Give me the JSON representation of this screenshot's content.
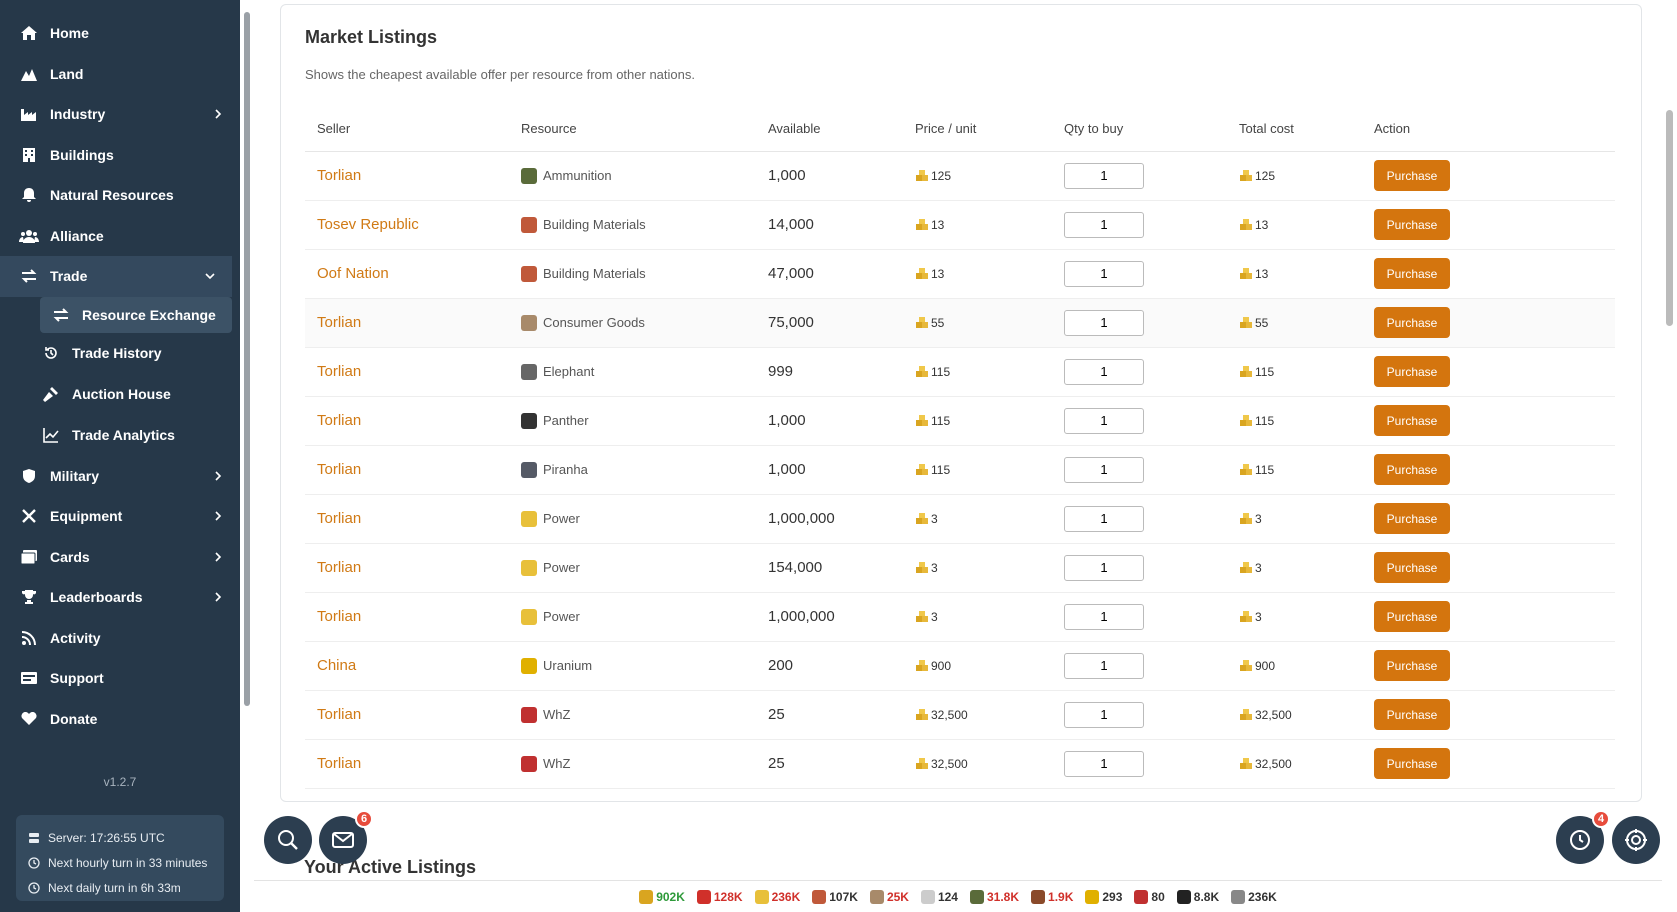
{
  "sidebar": {
    "items": [
      {
        "label": "Home",
        "icon": "home-icon"
      },
      {
        "label": "Land",
        "icon": "mountain-icon"
      },
      {
        "label": "Industry",
        "icon": "factory-icon"
      },
      {
        "label": "Buildings",
        "icon": "building-icon"
      },
      {
        "label": "Natural Resources",
        "icon": "bell-icon"
      },
      {
        "label": "Alliance",
        "icon": "users-icon"
      },
      {
        "label": "Trade",
        "icon": "exchange-icon"
      },
      {
        "label": "Military",
        "icon": "shield-icon"
      },
      {
        "label": "Equipment",
        "icon": "tools-icon"
      },
      {
        "label": "Cards",
        "icon": "images-icon"
      },
      {
        "label": "Leaderboards",
        "icon": "trophy-icon"
      },
      {
        "label": "Activity",
        "icon": "rss-icon"
      },
      {
        "label": "Support",
        "icon": "card-icon"
      },
      {
        "label": "Donate",
        "icon": "heart-icon"
      }
    ],
    "trade_sub": [
      {
        "label": "Resource Exchange"
      },
      {
        "label": "Trade History"
      },
      {
        "label": "Auction House"
      },
      {
        "label": "Trade Analytics"
      }
    ],
    "version": "v1.2.7",
    "server_time": "Server: 17:26:55 UTC",
    "next_hourly": "Next hourly turn in 33 minutes",
    "next_daily": "Next daily turn in 6h 33m"
  },
  "market": {
    "title": "Market Listings",
    "subtitle": "Shows the cheapest available offer per resource from other nations.",
    "headers": {
      "seller": "Seller",
      "resource": "Resource",
      "available": "Available",
      "price": "Price / unit",
      "qty": "Qty to buy",
      "total": "Total cost",
      "action": "Action"
    },
    "purchase_label": "Purchase",
    "rows": [
      {
        "seller": "Torlian",
        "resource": "Ammunition",
        "available": "1,000",
        "price": "125",
        "qty": "1",
        "total": "125",
        "color": "#5a6b3a"
      },
      {
        "seller": "Tosev Republic",
        "resource": "Building Materials",
        "available": "14,000",
        "price": "13",
        "qty": "1",
        "total": "13",
        "color": "#c0593a"
      },
      {
        "seller": "Oof Nation",
        "resource": "Building Materials",
        "available": "47,000",
        "price": "13",
        "qty": "1",
        "total": "13",
        "color": "#c0593a"
      },
      {
        "seller": "Torlian",
        "resource": "Consumer Goods",
        "available": "75,000",
        "price": "55",
        "qty": "1",
        "total": "55",
        "color": "#a88a6a"
      },
      {
        "seller": "Torlian",
        "resource": "Elephant",
        "available": "999",
        "price": "115",
        "qty": "1",
        "total": "115",
        "color": "#666666"
      },
      {
        "seller": "Torlian",
        "resource": "Panther",
        "available": "1,000",
        "price": "115",
        "qty": "1",
        "total": "115",
        "color": "#333333"
      },
      {
        "seller": "Torlian",
        "resource": "Piranha",
        "available": "1,000",
        "price": "115",
        "qty": "1",
        "total": "115",
        "color": "#555a66"
      },
      {
        "seller": "Torlian",
        "resource": "Power",
        "available": "1,000,000",
        "price": "3",
        "qty": "1",
        "total": "3",
        "color": "#e8c03a"
      },
      {
        "seller": "Torlian",
        "resource": "Power",
        "available": "154,000",
        "price": "3",
        "qty": "1",
        "total": "3",
        "color": "#e8c03a"
      },
      {
        "seller": "Torlian",
        "resource": "Power",
        "available": "1,000,000",
        "price": "3",
        "qty": "1",
        "total": "3",
        "color": "#e8c03a"
      },
      {
        "seller": "China",
        "resource": "Uranium",
        "available": "200",
        "price": "900",
        "qty": "1",
        "total": "900",
        "color": "#e0b000"
      },
      {
        "seller": "Torlian",
        "resource": "WhZ",
        "available": "25",
        "price": "32,500",
        "qty": "1",
        "total": "32,500",
        "color": "#c03030"
      },
      {
        "seller": "Torlian",
        "resource": "WhZ",
        "available": "25",
        "price": "32,500",
        "qty": "1",
        "total": "32,500",
        "color": "#c03030"
      }
    ]
  },
  "active_listings_title": "Your Active Listings",
  "fabs": {
    "mail_badge": "6",
    "clock_badge": "4"
  },
  "bottom_bar": [
    {
      "value": "902K",
      "color": "#2e9a3a",
      "icon": "gold-icon",
      "icon_color": "#d9a520"
    },
    {
      "value": "128K",
      "color": "#d0302a",
      "icon": "meat-icon",
      "icon_color": "#d0302a"
    },
    {
      "value": "236K",
      "color": "#d0302a",
      "icon": "power-icon",
      "icon_color": "#e8c03a"
    },
    {
      "value": "107K",
      "color": "#333333",
      "icon": "materials-icon",
      "icon_color": "#c0593a"
    },
    {
      "value": "25K",
      "color": "#d0302a",
      "icon": "goods-icon",
      "icon_color": "#a88a6a"
    },
    {
      "value": "124",
      "color": "#333333",
      "icon": "stone-icon",
      "icon_color": "#cccccc"
    },
    {
      "value": "31.8K",
      "color": "#d0302a",
      "icon": "ammo-icon",
      "icon_color": "#5a6b3a"
    },
    {
      "value": "1.9K",
      "color": "#d0302a",
      "icon": "crate-icon",
      "icon_color": "#8a4a2a"
    },
    {
      "value": "293",
      "color": "#333333",
      "icon": "uranium-icon",
      "icon_color": "#e0b000"
    },
    {
      "value": "80",
      "color": "#333333",
      "icon": "whz-icon",
      "icon_color": "#c03030"
    },
    {
      "value": "8.8K",
      "color": "#333333",
      "icon": "key-icon",
      "icon_color": "#222222"
    },
    {
      "value": "236K",
      "color": "#333333",
      "icon": "money-icon",
      "icon_color": "#888888"
    }
  ]
}
